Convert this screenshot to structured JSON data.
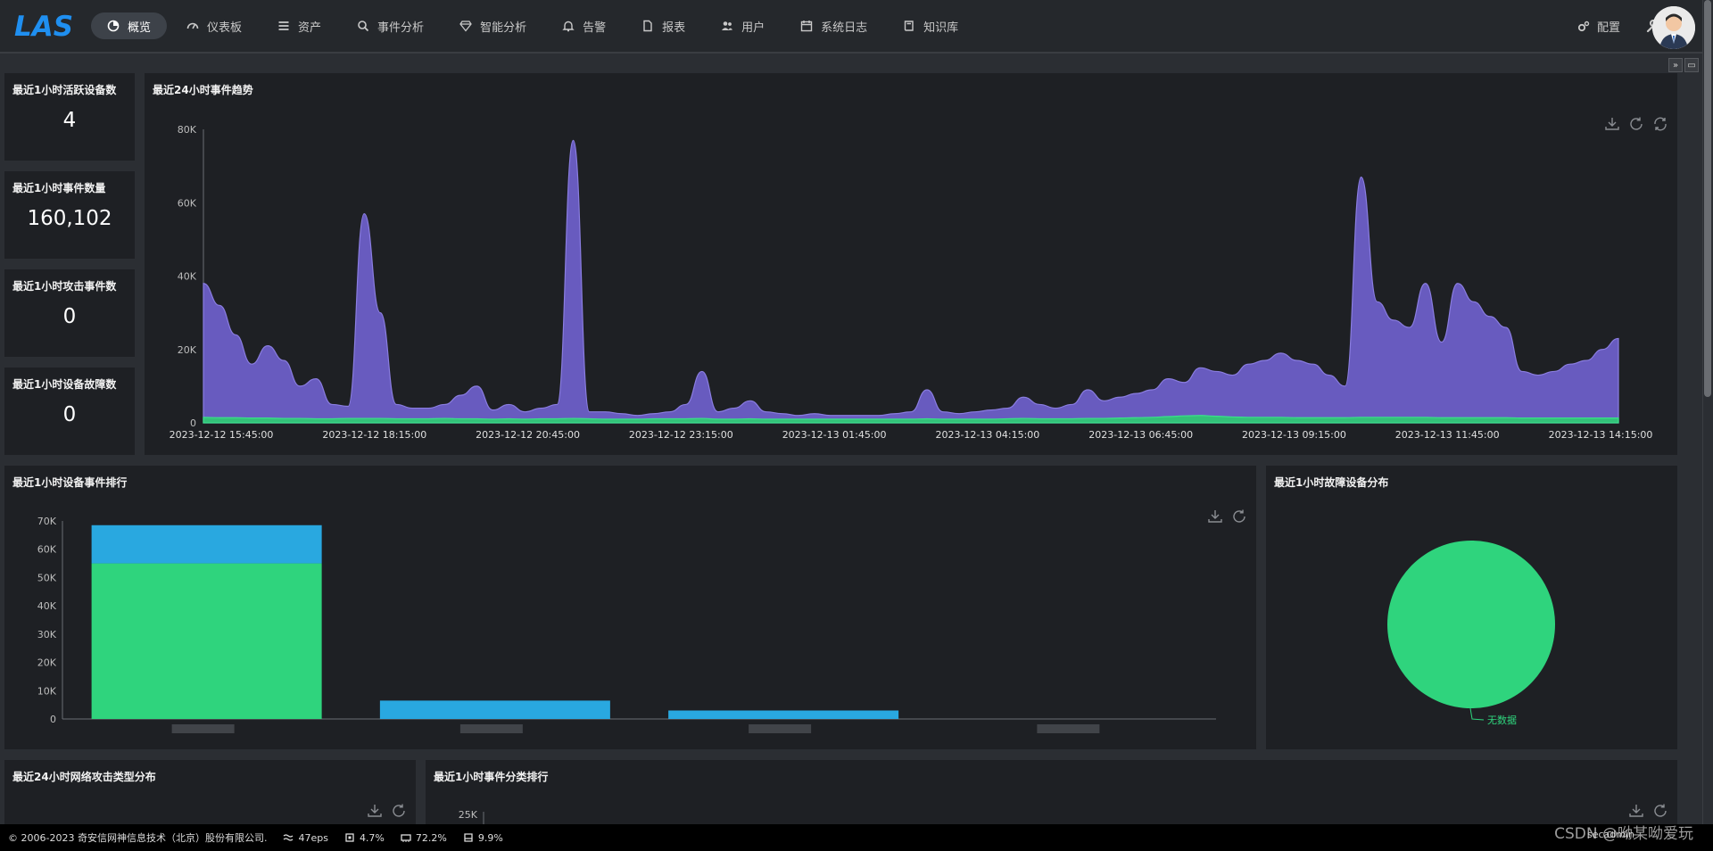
{
  "app": {
    "logo_text": "LAS"
  },
  "nav": [
    {
      "label": "概览",
      "icon": "pie-chart-icon",
      "active": true
    },
    {
      "label": "仪表板",
      "icon": "dashboard-icon",
      "active": false
    },
    {
      "label": "资产",
      "icon": "list-icon",
      "active": false
    },
    {
      "label": "事件分析",
      "icon": "search-icon",
      "active": false
    },
    {
      "label": "智能分析",
      "icon": "diamond-icon",
      "active": false
    },
    {
      "label": "告警",
      "icon": "bell-icon",
      "active": false
    },
    {
      "label": "报表",
      "icon": "file-icon",
      "active": false
    },
    {
      "label": "用户",
      "icon": "users-icon",
      "active": false
    },
    {
      "label": "系统日志",
      "icon": "calendar-icon",
      "active": false
    },
    {
      "label": "知识库",
      "icon": "book-icon",
      "active": false
    }
  ],
  "header_right": {
    "config_label": "配置"
  },
  "stats": [
    {
      "title": "最近1小时活跃设备数",
      "value": "4"
    },
    {
      "title": "最近1小时事件数量",
      "value": "160,102"
    },
    {
      "title": "最近1小时攻击事件数",
      "value": "0"
    },
    {
      "title": "最近1小时设备故障数",
      "value": "0"
    }
  ],
  "panels": {
    "trend_title": "最近24小时事件趋势",
    "device_rank_title": "最近1小时设备事件排行",
    "fault_dist_title": "最近1小时故障设备分布",
    "attack_type_title": "最近24小时网络攻击类型分布",
    "category_rank_title": "最近1小时事件分类排行"
  },
  "chart_data": [
    {
      "type": "area",
      "title": "最近24小时事件趋势",
      "colors": {
        "series_main": "#6d5fc8",
        "series_secondary": "#2ecc71"
      },
      "yticks": [
        "0",
        "20K",
        "40K",
        "60K",
        "80K"
      ],
      "ylim": [
        0,
        80000
      ],
      "xticks": [
        "2023-12-12 15:45:00",
        "2023-12-12 18:15:00",
        "2023-12-12 20:45:00",
        "2023-12-12 23:15:00",
        "2023-12-13 01:45:00",
        "2023-12-13 04:15:00",
        "2023-12-13 06:45:00",
        "2023-12-13 09:15:00",
        "2023-12-13 11:45:00",
        "2023-12-13 14:15:00"
      ],
      "series": [
        {
          "values": [
            38000,
            32000,
            24000,
            16000,
            21000,
            17000,
            10000,
            12000,
            5000,
            4500,
            57000,
            30000,
            5000,
            4000,
            4000,
            5000,
            7500,
            10000,
            3500,
            5000,
            3000,
            4000,
            5000,
            77000,
            3000,
            3000,
            2500,
            2000,
            2500,
            3000,
            5000,
            14000,
            3000,
            4000,
            6000,
            3000,
            2500,
            2000,
            2500,
            2000,
            2000,
            2000,
            2000,
            2500,
            3000,
            9000,
            3000,
            2500,
            3000,
            3500,
            4000,
            7000,
            5000,
            4000,
            5000,
            9000,
            6000,
            7000,
            8000,
            9000,
            12000,
            11000,
            15000,
            14000,
            13000,
            16000,
            17000,
            19000,
            17000,
            16000,
            13000,
            10000,
            67000,
            33000,
            28000,
            26000,
            38000,
            22000,
            38000,
            33000,
            29000,
            26000,
            14000,
            13000,
            14000,
            16000,
            17000,
            20000,
            23000
          ]
        },
        {
          "values": [
            1500,
            1400,
            1400,
            1300,
            1300,
            1200,
            1200,
            1100,
            1100,
            1200,
            1200,
            1200,
            1100,
            1100,
            1100,
            1200,
            1100,
            1100,
            1000,
            1100,
            1000,
            1100,
            1100,
            1200,
            1100,
            1000,
            1000,
            1000,
            1100,
            1100,
            1100,
            1200,
            1000,
            1000,
            1100,
            1000,
            1000,
            1000,
            1000,
            1000,
            1000,
            1000,
            1000,
            1000,
            1000,
            1100,
            1000,
            1000,
            1000,
            1000,
            1100,
            1200,
            1100,
            1100,
            1100,
            1200,
            1200,
            1300,
            1400,
            1500,
            1700,
            1900,
            2000,
            1800,
            1600,
            1500,
            1500,
            1500,
            1400,
            1400,
            1400,
            1400,
            1500,
            1500,
            1500,
            1500,
            1500,
            1400,
            1400,
            1400,
            1400,
            1400,
            1300,
            1300,
            1300,
            1300,
            1300,
            1300,
            1300
          ]
        }
      ]
    },
    {
      "type": "bar",
      "title": "最近1小时设备事件排行",
      "colors": {
        "bottom": "#2fd47d",
        "top": "#29a8e0"
      },
      "yticks": [
        "0",
        "10K",
        "20K",
        "30K",
        "40K",
        "50K",
        "60K",
        "70K"
      ],
      "ylim": [
        0,
        70000
      ],
      "series": [
        {
          "values": [
            55000,
            0,
            0,
            0
          ]
        },
        {
          "values": [
            13500,
            6500,
            3000,
            0
          ]
        }
      ]
    },
    {
      "type": "pie",
      "title": "最近1小时故障设备分布",
      "colors": {
        "slice": "#2fd47d"
      },
      "slices": [
        {
          "label": "无数据",
          "value": 1
        }
      ]
    },
    {
      "type": "bar",
      "title": "最近1小时事件分类排行",
      "yticks": [
        "25K"
      ]
    }
  ],
  "footer": {
    "copyright": "© 2006-2023 奇安信网神信息技术（北京）股份有限公司.",
    "eps": "47eps",
    "cpu": "4.7%",
    "mem": "72.2%",
    "disk": "9.9%",
    "user": "secadmin",
    "watermark": "CSDN @呦某呦爱玩"
  }
}
